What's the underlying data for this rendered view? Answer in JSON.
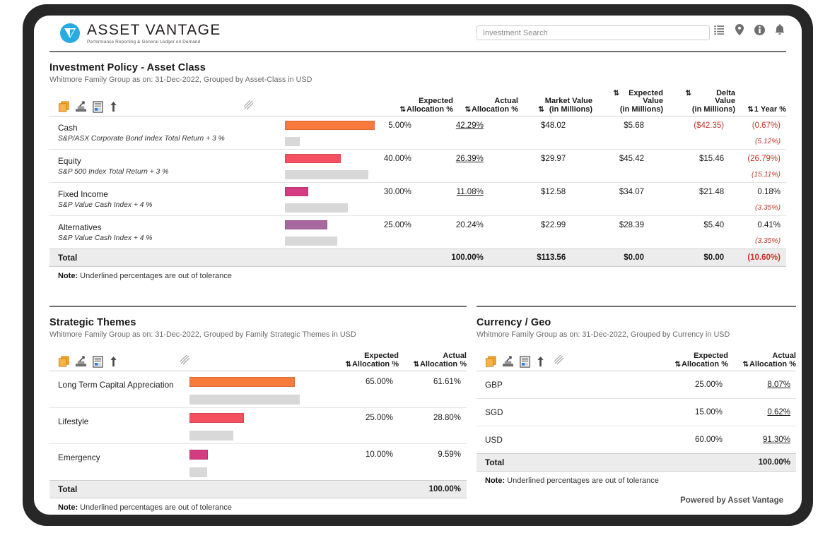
{
  "brand": {
    "name": "ASSET VANTAGE",
    "tagline": "Performance Reporting & General Ledger on Demand",
    "logo_color": "#29ABE2"
  },
  "header": {
    "search": {
      "placeholder": "Investment Search",
      "value": ""
    },
    "icons": [
      "list-icon",
      "location-pin-icon",
      "info-icon",
      "bell-icon"
    ]
  },
  "toolbar_icons": [
    "copy-icon",
    "export-icon",
    "report-icon",
    "upload-arrow-icon"
  ],
  "colors": {
    "bar_orange": "#F97A3D",
    "bar_red": "#F5505F",
    "bar_magenta": "#D43C81",
    "bar_purple": "#A8679F",
    "bar_expected_gray": "#D8D8D8",
    "negative_red": "#C0392B",
    "total_row_bg": "#ECECEC"
  },
  "asset_class_panel": {
    "title": "Investment Policy - Asset Class",
    "subtitle": "Whitmore Family Group as on: 31-Dec-2022, Grouped by Asset-Class in USD",
    "columns": [
      "Expected Allocation %",
      "Actual Allocation %",
      "Market Value (in Millions)",
      "Expected Value (in Millions)",
      "Delta Value (in Millions)",
      "1 Year %"
    ],
    "rows": [
      {
        "name": "Cash",
        "benchmark": "S&P/ASX Corporate Bond Index Total Return + 3 %",
        "expected_allocation": "5.00%",
        "actual_allocation": "42.29%",
        "actual_out_of_tolerance": true,
        "market_value": "$48.02",
        "expected_value": "$5.68",
        "delta_value": "($42.35)",
        "delta_negative": true,
        "one_year": "(0.67%)",
        "one_year_negative": true,
        "benchmark_one_year": "(5.12%)",
        "bar_actual_color": "#F97A3D",
        "bar_actual_width": 127,
        "bar_expected_width": 21
      },
      {
        "name": "Equity",
        "benchmark": "S&P 500 Index Total Return + 3 %",
        "expected_allocation": "40.00%",
        "actual_allocation": "26.39%",
        "actual_out_of_tolerance": true,
        "market_value": "$29.97",
        "expected_value": "$45.42",
        "delta_value": "$15.46",
        "delta_negative": false,
        "one_year": "(26.79%)",
        "one_year_negative": true,
        "benchmark_one_year": "(15.11%)",
        "bar_actual_color": "#F5505F",
        "bar_actual_width": 79,
        "bar_expected_width": 118
      },
      {
        "name": "Fixed Income",
        "benchmark": "S&P Value Cash Index + 4 %",
        "expected_allocation": "30.00%",
        "actual_allocation": "11.08%",
        "actual_out_of_tolerance": true,
        "market_value": "$12.58",
        "expected_value": "$34.07",
        "delta_value": "$21.48",
        "delta_negative": false,
        "one_year": "0.18%",
        "one_year_negative": false,
        "benchmark_one_year": "(3.35%)",
        "bar_actual_color": "#D43C81",
        "bar_actual_width": 33,
        "bar_expected_width": 89
      },
      {
        "name": "Alternatives",
        "benchmark": "S&P Value Cash Index + 4 %",
        "expected_allocation": "25.00%",
        "actual_allocation": "20.24%",
        "actual_out_of_tolerance": false,
        "market_value": "$22.99",
        "expected_value": "$28.39",
        "delta_value": "$5.40",
        "delta_negative": false,
        "one_year": "0.41%",
        "one_year_negative": false,
        "benchmark_one_year": "(3.35%)",
        "bar_actual_color": "#A8679F",
        "bar_actual_width": 60,
        "bar_expected_width": 74
      }
    ],
    "total": {
      "label": "Total",
      "expected_allocation": "",
      "actual_allocation": "100.00%",
      "market_value": "$113.56",
      "expected_value": "$0.00",
      "delta_value": "$0.00",
      "one_year": "(10.60%)",
      "one_year_negative": true
    },
    "note_label": "Note:",
    "note_text": " Underlined percentages are out of tolerance"
  },
  "themes_panel": {
    "title": "Strategic Themes",
    "subtitle": "Whitmore Family Group as on: 31-Dec-2022, Grouped by Family Strategic Themes in USD",
    "columns": [
      "Expected Allocation %",
      "Actual Allocation %"
    ],
    "rows": [
      {
        "name": "Long Term Capital Appreciation",
        "expected_allocation": "65.00%",
        "actual_allocation": "61.61%",
        "actual_out_of_tolerance": false,
        "bar_actual_color": "#F97A3D",
        "bar_actual_width": 149,
        "bar_expected_width": 156
      },
      {
        "name": "Lifestyle",
        "expected_allocation": "25.00%",
        "actual_allocation": "28.80%",
        "actual_out_of_tolerance": false,
        "bar_actual_color": "#F5505F",
        "bar_actual_width": 77,
        "bar_expected_width": 62
      },
      {
        "name": "Emergency",
        "expected_allocation": "10.00%",
        "actual_allocation": "9.59%",
        "actual_out_of_tolerance": false,
        "bar_actual_color": "#D43C81",
        "bar_actual_width": 26,
        "bar_expected_width": 25
      }
    ],
    "total": {
      "label": "Total",
      "expected_allocation": "",
      "actual_allocation": "100.00%"
    },
    "note_label": "Note:",
    "note_text": " Underlined percentages are out of tolerance"
  },
  "currency_panel": {
    "title": "Currency / Geo",
    "subtitle": "Whitmore Family Group as on: 31-Dec-2022, Grouped by Currency in USD",
    "columns": [
      "Expected Allocation %",
      "Actual Allocation %"
    ],
    "rows": [
      {
        "name": "GBP",
        "expected_allocation": "25.00%",
        "actual_allocation": "8.07%",
        "actual_out_of_tolerance": true
      },
      {
        "name": "SGD",
        "expected_allocation": "15.00%",
        "actual_allocation": "0.62%",
        "actual_out_of_tolerance": true
      },
      {
        "name": "USD",
        "expected_allocation": "60.00%",
        "actual_allocation": "91.30%",
        "actual_out_of_tolerance": true
      }
    ],
    "total": {
      "label": "Total",
      "expected_allocation": "",
      "actual_allocation": "100.00%"
    },
    "note_label": "Note:",
    "note_text": " Underlined percentages are out of tolerance"
  },
  "footer": {
    "text": "Powered by Asset Vantage"
  }
}
